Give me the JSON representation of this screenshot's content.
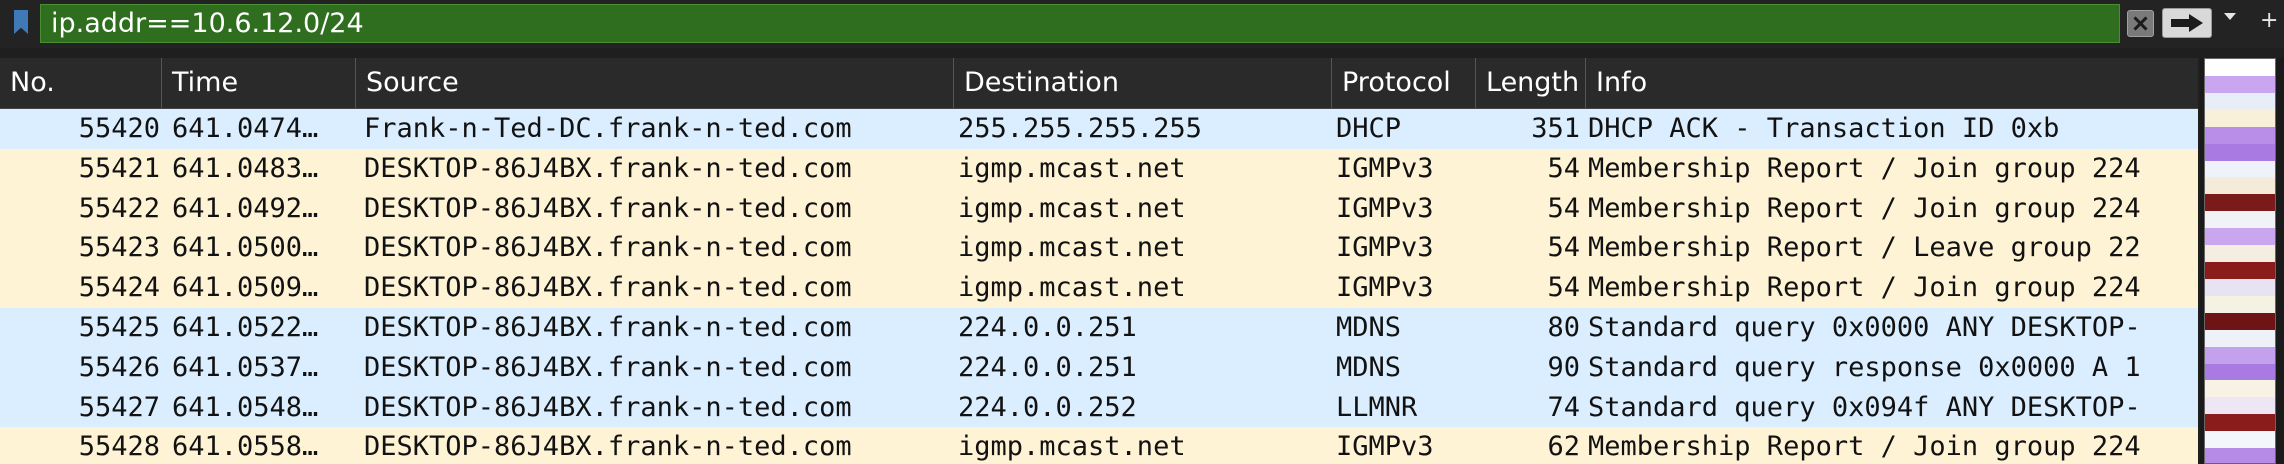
{
  "filter": {
    "text": "ip.addr==10.6.12.0/24"
  },
  "icons": {
    "bookmark": "bookmark-icon",
    "clear": "clear-icon",
    "apply": "arrow-right-icon",
    "dropdown": "chevron-down-icon",
    "add": "plus-icon"
  },
  "columns": [
    "No.",
    "Time",
    "Source",
    "Destination",
    "Protocol",
    "Length",
    "Info"
  ],
  "colors": {
    "filter_valid": "#2f6d1f",
    "row_udp": "#daeeff",
    "row_igmp": "#fff3d6",
    "header_bg": "#2a2a2a"
  },
  "packets": [
    {
      "no": "55420",
      "time": "641.0474…",
      "source": "Frank-n-Ted-DC.frank-n-ted.com",
      "destination": "255.255.255.255",
      "protocol": "DHCP",
      "length": "351",
      "info": "DHCP ACK      - Transaction ID 0xb",
      "color": "#daeeff"
    },
    {
      "no": "55421",
      "time": "641.0483…",
      "source": "DESKTOP-86J4BX.frank-n-ted.com",
      "destination": "igmp.mcast.net",
      "protocol": "IGMPv3",
      "length": "54",
      "info": "Membership Report / Join group 224",
      "color": "#fff3d6"
    },
    {
      "no": "55422",
      "time": "641.0492…",
      "source": "DESKTOP-86J4BX.frank-n-ted.com",
      "destination": "igmp.mcast.net",
      "protocol": "IGMPv3",
      "length": "54",
      "info": "Membership Report / Join group 224",
      "color": "#fff3d6"
    },
    {
      "no": "55423",
      "time": "641.0500…",
      "source": "DESKTOP-86J4BX.frank-n-ted.com",
      "destination": "igmp.mcast.net",
      "protocol": "IGMPv3",
      "length": "54",
      "info": "Membership Report / Leave group 22",
      "color": "#fff3d6"
    },
    {
      "no": "55424",
      "time": "641.0509…",
      "source": "DESKTOP-86J4BX.frank-n-ted.com",
      "destination": "igmp.mcast.net",
      "protocol": "IGMPv3",
      "length": "54",
      "info": "Membership Report / Join group 224",
      "color": "#fff3d6"
    },
    {
      "no": "55425",
      "time": "641.0522…",
      "source": "DESKTOP-86J4BX.frank-n-ted.com",
      "destination": "224.0.0.251",
      "protocol": "MDNS",
      "length": "80",
      "info": "Standard query 0x0000 ANY DESKTOP-",
      "color": "#daeeff"
    },
    {
      "no": "55426",
      "time": "641.0537…",
      "source": "DESKTOP-86J4BX.frank-n-ted.com",
      "destination": "224.0.0.251",
      "protocol": "MDNS",
      "length": "90",
      "info": "Standard query response 0x0000 A 1",
      "color": "#daeeff"
    },
    {
      "no": "55427",
      "time": "641.0548…",
      "source": "DESKTOP-86J4BX.frank-n-ted.com",
      "destination": "224.0.0.252",
      "protocol": "LLMNR",
      "length": "74",
      "info": "Standard query 0x094f ANY DESKTOP-",
      "color": "#daeeff"
    },
    {
      "no": "55428",
      "time": "641.0558…",
      "source": "DESKTOP-86J4BX.frank-n-ted.com",
      "destination": "igmp.mcast.net",
      "protocol": "IGMPv3",
      "length": "62",
      "info": "Membership Report / Join group 224",
      "color": "#fff3d6"
    }
  ],
  "minimap": [
    {
      "color": "#ffffff"
    },
    {
      "color": "#c9a6ef"
    },
    {
      "color": "#e7eef8"
    },
    {
      "color": "#f8f0d8"
    },
    {
      "color": "#b98ee8"
    },
    {
      "color": "#a97ae2"
    },
    {
      "color": "#eef3fb"
    },
    {
      "color": "#f4ecd9"
    },
    {
      "color": "#7a1a1a"
    },
    {
      "color": "#f0f2f6"
    },
    {
      "color": "#c9a6ef"
    },
    {
      "color": "#f3eee0"
    },
    {
      "color": "#8b1c1c"
    },
    {
      "color": "#e8e3f2"
    },
    {
      "color": "#f5f1e3"
    },
    {
      "color": "#6e1414"
    },
    {
      "color": "#eef1f6"
    },
    {
      "color": "#c4a1ec"
    },
    {
      "color": "#a97ae2"
    },
    {
      "color": "#f7f2e4"
    },
    {
      "color": "#ece6f5"
    },
    {
      "color": "#8b1c1c"
    },
    {
      "color": "#f3f6fa"
    },
    {
      "color": "#b58be7"
    }
  ]
}
